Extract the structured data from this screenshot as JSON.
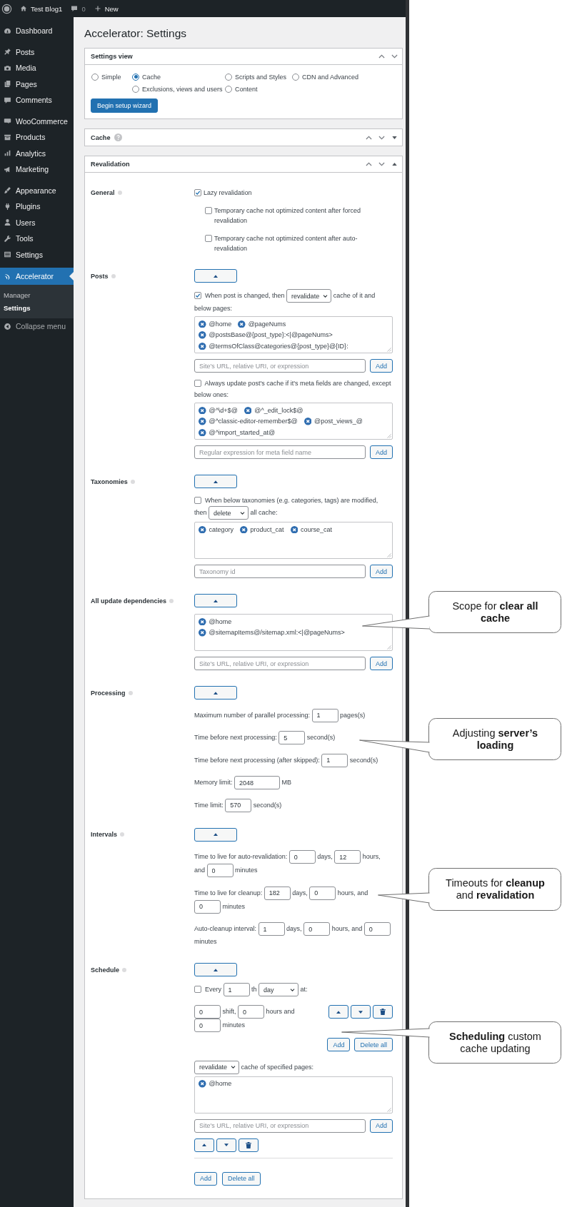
{
  "admin_bar": {
    "site": "Test Blog1",
    "comments": "0",
    "new": "New"
  },
  "sidebar": {
    "groups": [
      {
        "items": [
          {
            "label": "Dashboard",
            "selected": false
          }
        ]
      },
      {
        "items": [
          {
            "label": "Posts",
            "selected": false
          },
          {
            "label": "Media",
            "selected": false
          },
          {
            "label": "Pages",
            "selected": false
          },
          {
            "label": "Comments",
            "selected": false
          }
        ]
      },
      {
        "items": [
          {
            "label": "WooCommerce",
            "selected": false
          },
          {
            "label": "Products",
            "selected": false
          },
          {
            "label": "Analytics",
            "selected": false
          },
          {
            "label": "Marketing",
            "selected": false
          }
        ]
      },
      {
        "items": [
          {
            "label": "Appearance",
            "selected": false
          },
          {
            "label": "Plugins",
            "selected": false
          },
          {
            "label": "Users",
            "selected": false
          },
          {
            "label": "Tools",
            "selected": false
          },
          {
            "label": "Settings",
            "selected": false
          }
        ]
      },
      {
        "items": [
          {
            "label": "Accelerator",
            "selected": true,
            "submenu": [
              {
                "label": "Manager",
                "selected": false
              },
              {
                "label": "Settings",
                "selected": true
              }
            ]
          }
        ]
      }
    ],
    "collapse": "Collapse menu"
  },
  "page_title": "Accelerator: Settings",
  "settings_view": {
    "title": "Settings view",
    "options": [
      {
        "label": "Simple",
        "selected": false
      },
      {
        "label": "Cache",
        "selected": true
      },
      {
        "label": "Scripts and Styles",
        "selected": false
      },
      {
        "label": "CDN and Advanced",
        "selected": false
      },
      {
        "label": "Exclusions, views and users",
        "selected": false
      },
      {
        "label": "Content",
        "selected": false
      }
    ],
    "button": "Begin setup wizard"
  },
  "cache_panel": {
    "title": "Cache",
    "help": true,
    "expanded": false
  },
  "revalidation": {
    "title": "Revalidation",
    "expanded": true,
    "sections": [
      {
        "label": "General",
        "rows": [
          {
            "kind": "check",
            "checked": true,
            "text": "Lazy revalidation",
            "children": [
              {
                "checked": false,
                "text": "Temporary cache not optimized content after forced revalidation"
              },
              {
                "checked": false,
                "text": "Temporary cache not optimized content after auto-revalidation"
              }
            ]
          }
        ]
      },
      {
        "label": "Posts",
        "expanded": true,
        "rows": [
          {
            "kind": "inline",
            "lines": [
              [
                {
                  "kind": "checkbox",
                  "checked": true
                },
                {
                  "kind": "text",
                  "text": "When post is changed, then"
                },
                {
                  "kind": "select",
                  "value": "revalidate"
                },
                {
                  "kind": "text",
                  "text": "cache of it and"
                }
              ],
              [
                {
                  "kind": "text",
                  "text": "below pages:"
                }
              ]
            ]
          },
          {
            "kind": "tags",
            "items": [
              "@home",
              "@pageNums",
              "@postsBase@{post_type}:<|@pageNums>",
              "@termsOfClass@categories@{post_type}@{ID}:"
            ]
          },
          {
            "kind": "add",
            "placeholder": "Site's URL, relative URI, or expression",
            "button": "Add"
          },
          {
            "kind": "inline",
            "lines": [
              [
                {
                  "kind": "checkbox",
                  "checked": false
                },
                {
                  "kind": "text",
                  "text": "Always update post's cache if it's meta fields are changed, except"
                }
              ],
              [
                {
                  "kind": "text",
                  "text": "below ones:"
                }
              ]
            ]
          },
          {
            "kind": "tags",
            "items": [
              "@^\\d+$@",
              "@^_edit_lock$@",
              "@^classic-editor-remember$@",
              "@post_views_@",
              "@^import_started_at@"
            ]
          },
          {
            "kind": "add",
            "placeholder": "Regular expression for meta field name",
            "button": "Add"
          }
        ]
      },
      {
        "label": "Taxonomies",
        "expanded": true,
        "rows": [
          {
            "kind": "inline",
            "lines": [
              [
                {
                  "kind": "checkbox",
                  "checked": false
                },
                {
                  "kind": "text",
                  "text": "When below taxonomies (e.g. categories, tags) are modified,"
                }
              ],
              [
                {
                  "kind": "text",
                  "text": "then"
                },
                {
                  "kind": "select",
                  "value": "delete"
                },
                {
                  "kind": "text",
                  "text": "all cache:"
                }
              ]
            ]
          },
          {
            "kind": "tags",
            "items": [
              "category",
              "product_cat",
              "course_cat"
            ]
          },
          {
            "kind": "add",
            "placeholder": "Taxonomy id",
            "button": "Add"
          }
        ]
      },
      {
        "label": "All update dependencies",
        "expanded": true,
        "rows": [
          {
            "kind": "tags",
            "items": [
              "@home",
              "@sitemapItems@/sitemap.xml:<|@pageNums>"
            ]
          },
          {
            "kind": "add",
            "placeholder": "Site's URL, relative URI, or expression",
            "button": "Add"
          }
        ]
      },
      {
        "label": "Processing",
        "expanded": true,
        "rows": [
          {
            "kind": "inline",
            "lines": [
              [
                {
                  "kind": "text",
                  "text": "Maximum number of parallel processing:"
                },
                {
                  "kind": "input",
                  "value": "1"
                },
                {
                  "kind": "text",
                  "text": "pages(s)"
                }
              ]
            ]
          },
          {
            "kind": "inline",
            "lines": [
              [
                {
                  "kind": "text",
                  "text": "Time before next processing:"
                },
                {
                  "kind": "input",
                  "value": "5"
                },
                {
                  "kind": "text",
                  "text": "second(s)"
                }
              ]
            ]
          },
          {
            "kind": "inline",
            "lines": [
              [
                {
                  "kind": "text",
                  "text": "Time before next processing (after skipped):"
                },
                {
                  "kind": "input",
                  "value": "1"
                },
                {
                  "kind": "text",
                  "text": "second(s)"
                }
              ]
            ]
          },
          {
            "kind": "inline",
            "lines": [
              [
                {
                  "kind": "text",
                  "text": "Memory limit:"
                },
                {
                  "kind": "input",
                  "value": "2048"
                },
                {
                  "kind": "text",
                  "text": "MB"
                }
              ]
            ]
          },
          {
            "kind": "inline",
            "lines": [
              [
                {
                  "kind": "text",
                  "text": "Time limit:"
                },
                {
                  "kind": "input",
                  "value": "570"
                },
                {
                  "kind": "text",
                  "text": "second(s)"
                }
              ]
            ]
          }
        ]
      },
      {
        "label": "Intervals",
        "expanded": true,
        "rows": [
          {
            "kind": "inline",
            "lines": [
              [
                {
                  "kind": "text",
                  "text": "Time to live for auto-revalidation:"
                },
                {
                  "kind": "input",
                  "value": "0"
                },
                {
                  "kind": "text",
                  "text": "days,"
                },
                {
                  "kind": "input",
                  "value": "12"
                },
                {
                  "kind": "text",
                  "text": "hours,"
                }
              ],
              [
                {
                  "kind": "text",
                  "text": "and"
                },
                {
                  "kind": "input",
                  "value": "0"
                },
                {
                  "kind": "text",
                  "text": "minutes"
                }
              ]
            ]
          },
          {
            "kind": "inline",
            "lines": [
              [
                {
                  "kind": "text",
                  "text": "Time to live for cleanup:"
                },
                {
                  "kind": "input",
                  "value": "182"
                },
                {
                  "kind": "text",
                  "text": "days,"
                },
                {
                  "kind": "input",
                  "value": "0"
                },
                {
                  "kind": "text",
                  "text": "hours, and"
                }
              ],
              [
                {
                  "kind": "input",
                  "value": "0"
                },
                {
                  "kind": "text",
                  "text": "minutes"
                }
              ]
            ]
          },
          {
            "kind": "inline",
            "lines": [
              [
                {
                  "kind": "text",
                  "text": "Auto-cleanup interval:"
                },
                {
                  "kind": "input",
                  "value": "1"
                },
                {
                  "kind": "text",
                  "text": "days,"
                },
                {
                  "kind": "input",
                  "value": "0"
                },
                {
                  "kind": "text",
                  "text": "hours, and"
                },
                {
                  "kind": "input",
                  "value": "0"
                }
              ],
              [
                {
                  "kind": "text",
                  "text": "minutes"
                }
              ]
            ]
          }
        ]
      },
      {
        "label": "Schedule",
        "expanded": true,
        "rows": [
          {
            "kind": "inline",
            "lines": [
              [
                {
                  "kind": "checkbox",
                  "checked": false
                },
                {
                  "kind": "text",
                  "text": "Every"
                },
                {
                  "kind": "input",
                  "value": "1"
                },
                {
                  "kind": "text",
                  "text": "th"
                },
                {
                  "kind": "select",
                  "value": "day"
                },
                {
                  "kind": "text",
                  "text": "at:"
                }
              ]
            ]
          },
          {
            "kind": "time_row",
            "lines": [
              [
                {
                  "kind": "input",
                  "value": "0"
                },
                {
                  "kind": "text",
                  "text": "shift,"
                },
                {
                  "kind": "input",
                  "value": "0"
                },
                {
                  "kind": "text",
                  "text": "hours and"
                }
              ],
              [
                {
                  "kind": "input",
                  "value": "0"
                },
                {
                  "kind": "text",
                  "text": "minutes"
                }
              ]
            ]
          },
          {
            "kind": "list_actions",
            "buttons": [
              "Add",
              "Delete all"
            ]
          },
          {
            "kind": "inline",
            "lines": [
              [
                {
                  "kind": "select",
                  "value": "revalidate"
                },
                {
                  "kind": "text",
                  "text": "cache of specified pages:"
                }
              ]
            ]
          },
          {
            "kind": "tags",
            "items": [
              "@home"
            ]
          },
          {
            "kind": "add",
            "placeholder": "Site's URL, relative URI, or expression",
            "button": "Add"
          },
          {
            "kind": "item_controls"
          },
          {
            "kind": "actions",
            "buttons": [
              "Add",
              "Delete all"
            ]
          }
        ]
      }
    ]
  },
  "callouts": [
    {
      "text": "Scope for **clear all cache**"
    },
    {
      "text": "Adjusting **server’s loading**"
    },
    {
      "text": "Timeouts for **cleanup** and **revalidation**"
    },
    {
      "text": "**Scheduling** custom cache updating"
    }
  ]
}
